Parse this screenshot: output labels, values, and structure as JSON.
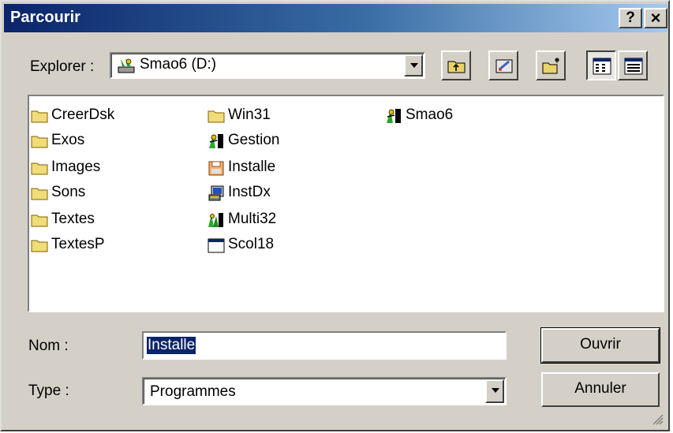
{
  "window": {
    "title": "Parcourir",
    "help_label": "?",
    "close_label": "×"
  },
  "look_in": {
    "label": "Explorer :",
    "value": "Smao6 (D:)"
  },
  "files": [
    {
      "name": "CreerDsk",
      "icon": "folder-icon"
    },
    {
      "name": "Exos",
      "icon": "folder-icon"
    },
    {
      "name": "Images",
      "icon": "folder-icon"
    },
    {
      "name": "Sons",
      "icon": "folder-icon"
    },
    {
      "name": "Textes",
      "icon": "folder-icon"
    },
    {
      "name": "TextesP",
      "icon": "folder-icon"
    },
    {
      "name": "Win31",
      "icon": "folder-icon"
    },
    {
      "name": "Gestion",
      "icon": "program-icon"
    },
    {
      "name": "Installe",
      "icon": "installer-icon"
    },
    {
      "name": "InstDx",
      "icon": "setup-icon"
    },
    {
      "name": "Multi32",
      "icon": "program-icon"
    },
    {
      "name": "Scol18",
      "icon": "window-app-icon"
    },
    {
      "name": "Smao6",
      "icon": "program-icon"
    }
  ],
  "filename": {
    "label": "Nom :",
    "value": "Installe"
  },
  "filetype": {
    "label": "Type :",
    "value": "Programmes"
  },
  "buttons": {
    "open": "Ouvrir",
    "cancel": "Annuler"
  }
}
